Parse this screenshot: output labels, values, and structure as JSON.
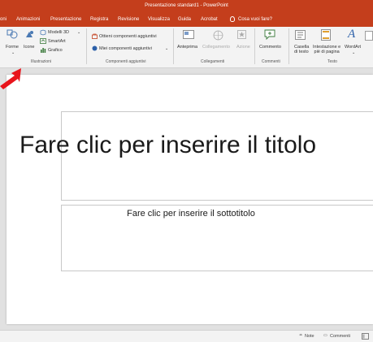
{
  "window": {
    "title": "Presentazione standard1  -  PowerPoint"
  },
  "tabs": [
    {
      "label": "oni"
    },
    {
      "label": "Animazioni"
    },
    {
      "label": "Presentazione"
    },
    {
      "label": "Registra"
    },
    {
      "label": "Revisione"
    },
    {
      "label": "Visualizza"
    },
    {
      "label": "Guida"
    },
    {
      "label": "Acrobat"
    }
  ],
  "tell_me": {
    "placeholder": "Cosa vuoi fare?"
  },
  "ribbon": {
    "illustrazioni": {
      "label": "Illustrazioni",
      "forme": "Forme",
      "icone": "Icone",
      "modelli3d": "Modelli 3D",
      "smartart": "SmartArt",
      "grafico": "Grafico"
    },
    "componenti": {
      "label": "Componenti aggiuntivi",
      "ottieni": "Ottieni componenti aggiuntivi",
      "miei": "Miei componenti aggiuntivi"
    },
    "collegamenti": {
      "label": "Collegamenti",
      "anteprima": "Anteprima",
      "collegamento": "Collegamento",
      "azione": "Azione"
    },
    "commenti": {
      "label": "Commenti",
      "commento": "Commento"
    },
    "testo": {
      "label": "Testo",
      "casella_1": "Casella",
      "casella_2": "di testo",
      "intestazione_1": "Intestazione e",
      "intestazione_2": "piè di pagina",
      "wordart": "WordArt"
    }
  },
  "slide": {
    "title_placeholder": "Fare clic per inserire il titolo",
    "subtitle_placeholder": "Fare clic per inserire il sottotitolo"
  },
  "statusbar": {
    "notes": "Note",
    "comments": "Commenti"
  },
  "colors": {
    "accent": "#c43e1c",
    "annotation_arrow": "#e8141b"
  }
}
